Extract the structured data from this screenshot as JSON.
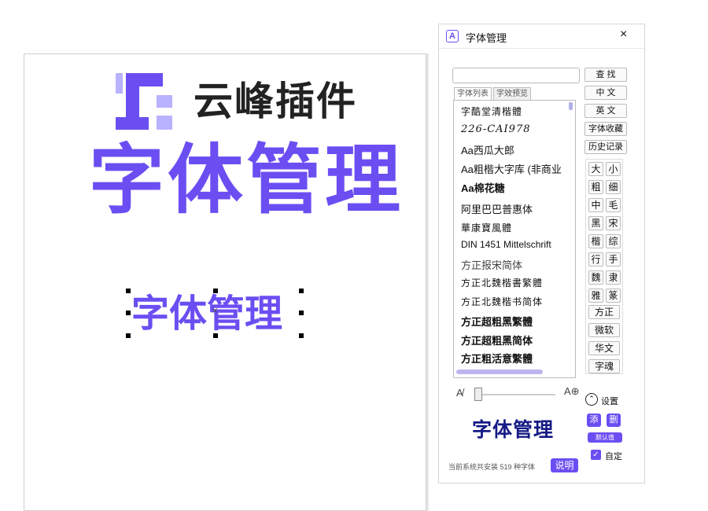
{
  "canvas": {
    "brand_name": "云峰插件",
    "hero_text": "字体管理",
    "selected_text": "字体管理",
    "colors": {
      "accent": "#6b4ef2",
      "accent_light": "#b9b2ff",
      "brand_text": "#222222"
    }
  },
  "panel": {
    "title": "字体管理",
    "close": "×",
    "search": {
      "value": "",
      "placeholder": ""
    },
    "tabs": [
      "字体列表",
      "字效预览"
    ],
    "font_list": [
      "字酷堂清楷體",
      "226-CAI978",
      "Aa西瓜大郎",
      "Aa粗楷大字库 (非商业",
      "Aa棉花糖",
      "阿里巴巴普惠体",
      "華康寶風體",
      "DIN 1451 Mittelschrift",
      "方正报宋简体",
      "方正北魏楷書繁體",
      "方正北魏楷书简体",
      "方正超粗黑繁體",
      "方正超粗黑简体",
      "方正粗活意繁體"
    ],
    "buttons": {
      "find": "查 找",
      "chinese": "中 文",
      "english": "英 文",
      "favorites": "字体收藏",
      "history": "历史记录"
    },
    "filters": [
      "大",
      "小",
      "粗",
      "细",
      "中",
      "毛",
      "黑",
      "宋",
      "楷",
      "综",
      "行",
      "手",
      "魏",
      "隶",
      "雅",
      "篆"
    ],
    "wide_filters": [
      "方正",
      "微软",
      "华文",
      "字魂"
    ],
    "settings_label": "设置",
    "preview_text": "字体管理",
    "add_label": "添",
    "delete_label": "删",
    "default_label": "默认值",
    "custom_label": "自定",
    "custom_checked": true,
    "status_text": "当前系统共安装 519 种字体",
    "help_label": "说明",
    "preview_color": "#151a85"
  }
}
